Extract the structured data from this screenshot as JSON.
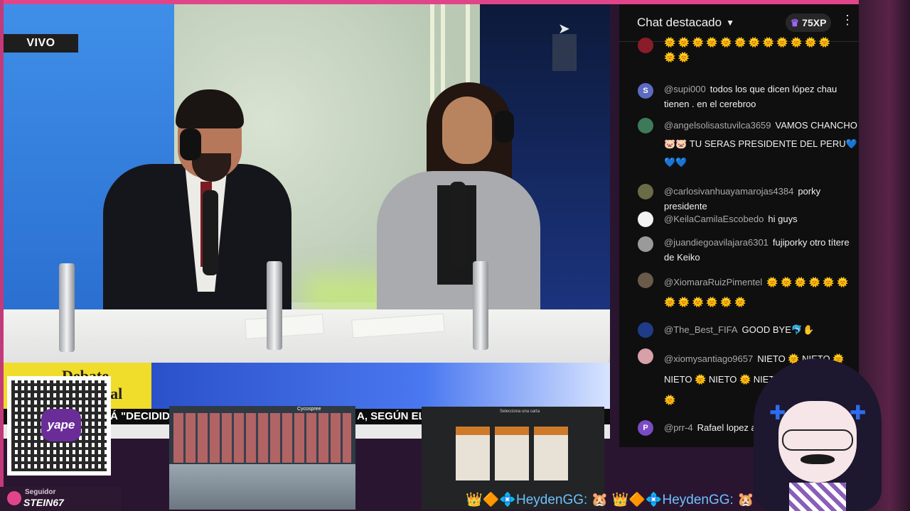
{
  "stream": {
    "live_badge": "VIVO",
    "show_label_line1": "Debate",
    "show_label_line2": "ial",
    "ticker_left": "Á \"DECIDIDO",
    "ticker_right": "A, SEGÚN EL S"
  },
  "chat": {
    "title": "Chat destacado",
    "xp": "75XP",
    "messages": [
      {
        "author": "",
        "text": "",
        "emotes": "🌞 🌞",
        "avatar_color": "#8a1c2a",
        "avatar_letter": ""
      },
      {
        "author": "@supi000",
        "text": "todos los que dicen lópez chau tienen . en el cerebroo",
        "emotes": "",
        "avatar_color": "#5c6bc0",
        "avatar_letter": "S"
      },
      {
        "author": "@angelsolisastuvilca3659",
        "text": "VAMOS CHANCHO 🐷🐷 TU SERAS PRESIDENTE DEL PERU💙 💙💙",
        "emotes": "",
        "avatar_color": "#3d7a5a",
        "avatar_letter": ""
      },
      {
        "author": "@carlosivanhuayamarojas4384",
        "text": "porky presidente",
        "emotes": "",
        "avatar_color": "#6b6b48",
        "avatar_letter": ""
      },
      {
        "author": "@KeilaCamilaEscobedo",
        "text": "hi guys",
        "emotes": "",
        "avatar_color": "#f2f2f2",
        "avatar_letter": ""
      },
      {
        "author": "@juandiegoavilajara6301",
        "text": "fujiporky otro títere de Keiko",
        "emotes": "",
        "avatar_color": "#9a9a9a",
        "avatar_letter": ""
      },
      {
        "author": "@XiomaraRuizPimentel",
        "text": "",
        "emotes": "🌞 🌞 🌞 🌞 🌞 🌞 🌞 🌞 🌞 🌞 🌞 🌞",
        "avatar_color": "#6a5a4a",
        "avatar_letter": ""
      },
      {
        "author": "@The_Best_FIFA",
        "text": "GOOD BYE🐬✋",
        "emotes": "",
        "avatar_color": "#1f3c88",
        "avatar_letter": ""
      },
      {
        "author": "@xiomysantiago9657",
        "text": "NIETO 🌞 NIETO 🌞 NIETO 🌞 NIETO 🌞 NIETO NIETO 🌞 NIETO 🌞",
        "emotes": "",
        "avatar_color": "#d8a0a8",
        "avatar_letter": ""
      },
      {
        "author": "@prr-4",
        "text": "Rafael lopez a",
        "emotes": "",
        "avatar_color": "#7b4bc4",
        "avatar_letter": "P"
      }
    ]
  },
  "overlays": {
    "qr_brand": "yape",
    "follower_label": "Seguidor",
    "follower_name": "STEIN67",
    "game1_header": "Cycospree",
    "game2_title": "Selecciona una carta",
    "donation_ticker": "👑🔶💠HeydenGG: 🐹 👑🔶💠HeydenGG: 🐹"
  }
}
